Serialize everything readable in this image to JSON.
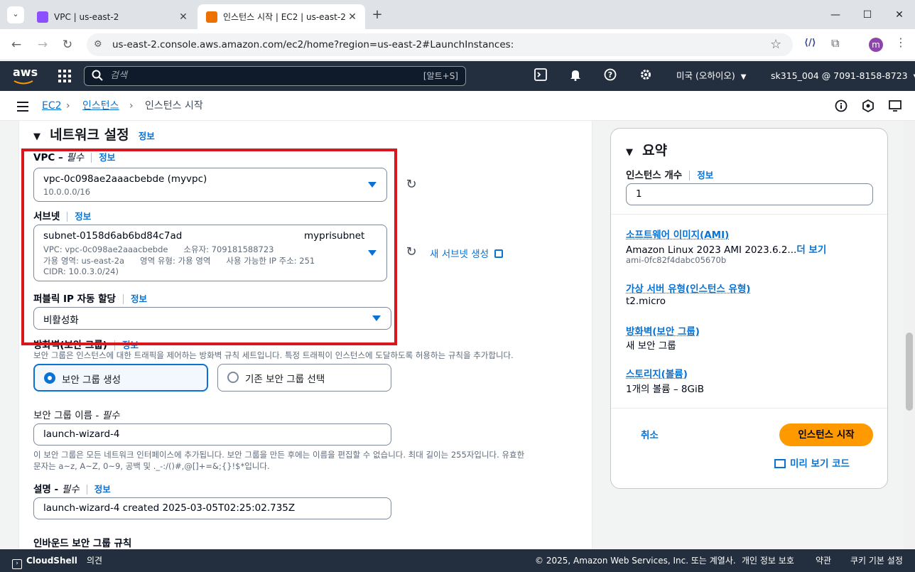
{
  "browser": {
    "tabs": [
      {
        "title": "VPC | us-east-2",
        "active": false
      },
      {
        "title": "인스턴스 시작 | EC2 | us-east-2",
        "active": true
      }
    ],
    "new_tab_icon": "plus-icon",
    "url": "us-east-2.console.aws.amazon.com/ec2/home?region=us-east-2#LaunchInstances:",
    "profile_initial": "m"
  },
  "aws_nav": {
    "logo": "aws",
    "search_placeholder": "검색",
    "search_shortcut": "[알트+S]",
    "region": "미국 (오하이오)",
    "account": "sk315_004 @ 7091-8158-8723"
  },
  "breadcrumb": {
    "items": [
      "EC2",
      "인스턴스",
      "인스턴스 시작"
    ]
  },
  "network": {
    "section_title": "네트워크 설정",
    "section_info": "정보",
    "vpc_label": "VPC – ",
    "vpc_required": "필수",
    "vpc_info": "정보",
    "vpc_value": "vpc-0c098ae2aaacbebde (myvpc)",
    "vpc_cidr": "10.0.0.0/16",
    "subnet_label": "서브넷",
    "subnet_info": "정보",
    "subnet_id": "subnet-0158d6ab6bd84c7ad",
    "subnet_name": "myprisubnet",
    "subnet_line1": "VPC: vpc-0c098ae2aaacbebde      소유자: 709181588723",
    "subnet_line2": "가용 영역: us-east-2a      영역 유형: 가용 영역      사용 가능한 IP 주소: 251",
    "subnet_line3": "CIDR: 10.0.3.0/24)",
    "new_subnet": "새 서브넷 생성",
    "public_ip_label": "퍼블릭 IP 자동 할당",
    "public_ip_info": "정보",
    "public_ip_value": "비활성화",
    "firewall_label": "방화벽(보안 그룹)",
    "firewall_info": "정보",
    "firewall_desc": "보안 그룹은 인스턴스에 대한 트래픽을 제어하는 방화벽 규칙 세트입니다. 특정 트래픽이 인스턴스에 도달하도록 허용하는 규칙을 추가합니다.",
    "radio_create": "보안 그룹 생성",
    "radio_existing": "기존 보안 그룹 선택",
    "sg_name_label": "보안 그룹 이름 - ",
    "sg_name_required": "필수",
    "sg_name_value": "launch-wizard-4",
    "sg_name_desc1": "이 보안 그룹은 모든 네트워크 인터페이스에 추가됩니다. 보안 그룹을 만든 후에는 이름을 편집할 수 없습니다. 최대 길이는 255자입니다. 유효한",
    "sg_name_desc2": "문자는 a~z, A~Z, 0~9, 공백 및 ._-:/()#,@[]+=&;{}!$*입니다.",
    "desc_label": "설명 - ",
    "desc_required": "필수",
    "desc_info": "정보",
    "desc_value": "launch-wizard-4 created 2025-03-05T02:25:02.735Z",
    "inbound_label": "인바운드 보안 그룹 규칙"
  },
  "summary": {
    "title": "요약",
    "count_label": "인스턴스 개수",
    "count_info": "정보",
    "count_value": "1",
    "ami_label": "소프트웨어 이미지(AMI)",
    "ami_value": "Amazon Linux 2023 AMI 2023.6.2...",
    "ami_more": "더 보기",
    "ami_id": "ami-0fc82f4dabc05670b",
    "type_label": "가상 서버 유형(인스턴스 유형)",
    "type_value": "t2.micro",
    "fw_label": "방화벽(보안 그룹)",
    "fw_value": "새 보안 그룹",
    "storage_label": "스토리지(볼륨)",
    "storage_value": "1개의 볼륨 – 8GiB",
    "cancel": "취소",
    "launch": "인스턴스 시작",
    "preview": "미리 보기 코드"
  },
  "footer": {
    "cloudshell": "CloudShell",
    "feedback": "의견",
    "copyright": "© 2025, Amazon Web Services, Inc. 또는 계열사.",
    "privacy": "개인 정보 보호",
    "terms": "약관",
    "cookies": "쿠키 기본 설정"
  },
  "colors": {
    "link": "#0972d3",
    "aws_nav_bg": "#232f3e",
    "launch_button": "#ff9900",
    "highlight_box": "#d9161b"
  }
}
